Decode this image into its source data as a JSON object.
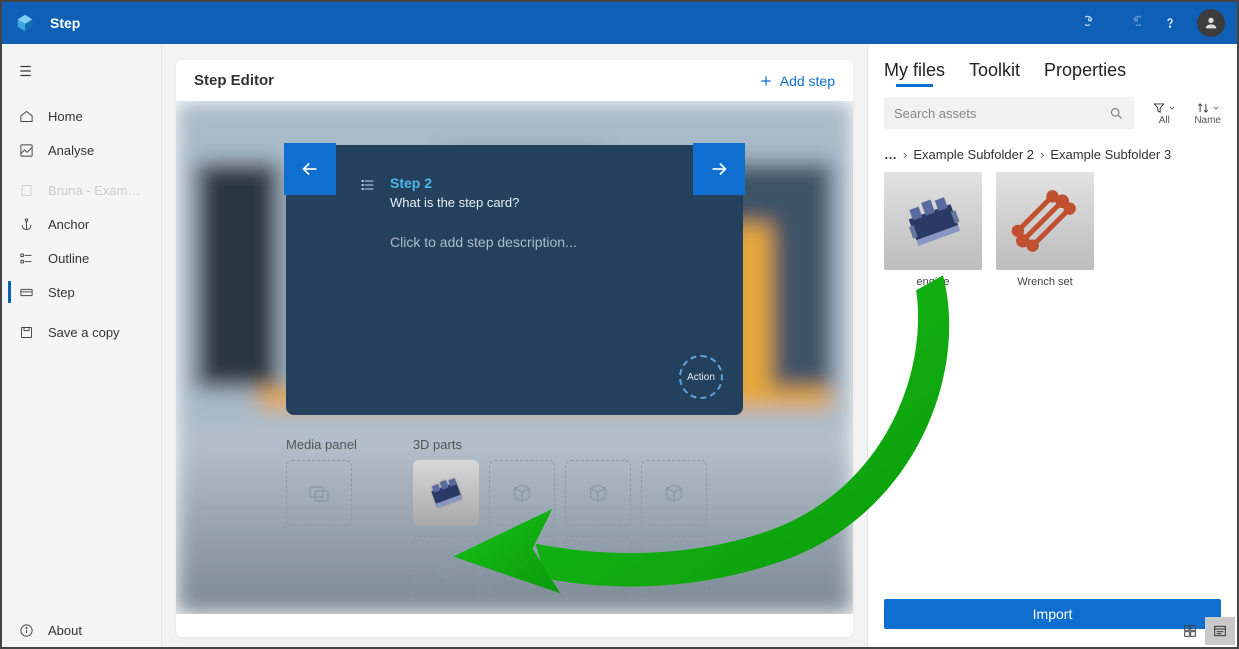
{
  "titlebar": {
    "title": "Step"
  },
  "sidebar": {
    "items": [
      {
        "label": "Home"
      },
      {
        "label": "Analyse"
      },
      {
        "label": "Bruna - Example Gui..."
      },
      {
        "label": "Anchor"
      },
      {
        "label": "Outline"
      },
      {
        "label": "Step"
      },
      {
        "label": "Save a copy"
      }
    ],
    "about": "About"
  },
  "editor": {
    "header_title": "Step Editor",
    "add_step": "Add step",
    "step_title": "Step 2",
    "step_subtitle": "What is the step card?",
    "placeholder": "Click to add step description...",
    "action_label": "Action",
    "media_panel_label": "Media panel",
    "parts_label": "3D parts"
  },
  "right": {
    "tabs": [
      {
        "label": "My files",
        "active": true
      },
      {
        "label": "Toolkit",
        "active": false
      },
      {
        "label": "Properties",
        "active": false
      }
    ],
    "search_placeholder": "Search assets",
    "filter_all": "All",
    "sort_name": "Name",
    "breadcrumb": {
      "ellipsis": "…",
      "crumb1": "Example Subfolder 2",
      "crumb2": "Example Subfolder 3"
    },
    "assets": [
      {
        "label": "engine"
      },
      {
        "label": "Wrench set"
      }
    ],
    "import": "Import"
  }
}
